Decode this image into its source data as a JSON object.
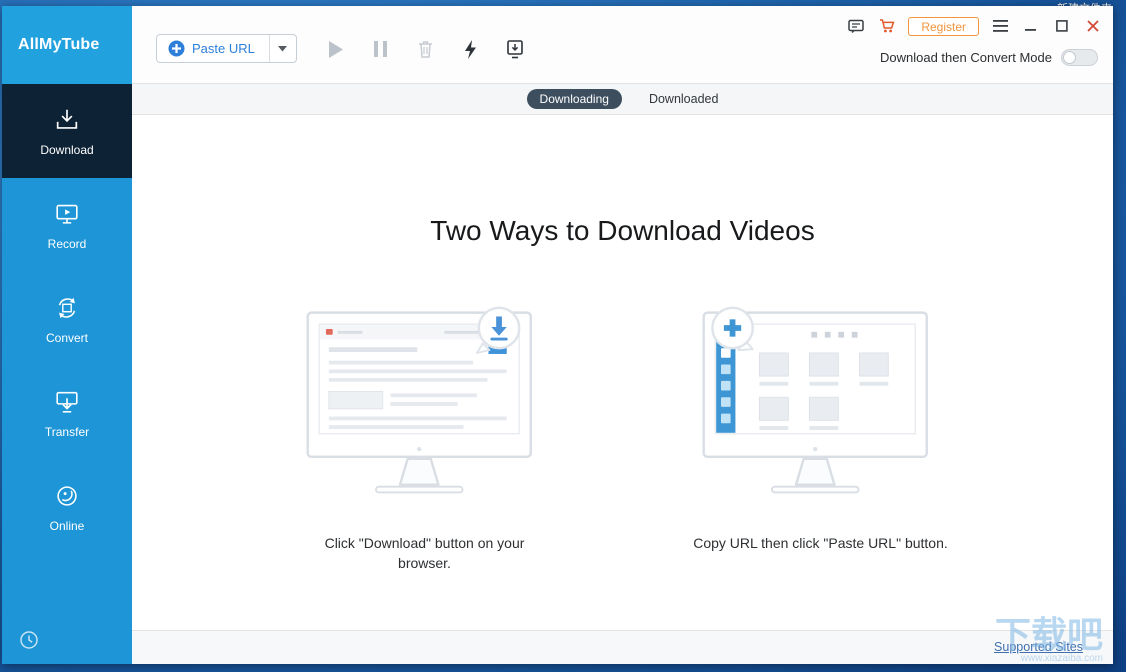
{
  "desktop": {
    "icon_label": "新建文件夹"
  },
  "window": {
    "app_name": "AllMyTube",
    "titlebar": {
      "register_label": "Register",
      "mode_label": "Download then Convert Mode"
    }
  },
  "toolbar": {
    "paste_url_label": "Paste URL"
  },
  "sidebar": {
    "items": [
      {
        "label": "Download"
      },
      {
        "label": "Record"
      },
      {
        "label": "Convert"
      },
      {
        "label": "Transfer"
      },
      {
        "label": "Online"
      }
    ]
  },
  "tabs": [
    {
      "label": "Downloading"
    },
    {
      "label": "Downloaded"
    }
  ],
  "content": {
    "heading": "Two Ways to Download Videos",
    "methods": [
      {
        "caption": "Click \"Download\" button on your browser."
      },
      {
        "caption": "Copy URL then click \"Paste URL\" button."
      }
    ]
  },
  "footer": {
    "supported_sites": "Supported Sites"
  },
  "watermark": {
    "text": "下载吧",
    "url": "www.xiazaiba.com"
  },
  "colors": {
    "sidebar_blue": "#1E95D6",
    "logo_blue": "#22A1DF",
    "active_navy": "#0E2236",
    "accent_blue": "#2D7FD9",
    "register_orange": "#F0953C",
    "tab_pill": "#3D4E5E",
    "close_red": "#D14836"
  }
}
